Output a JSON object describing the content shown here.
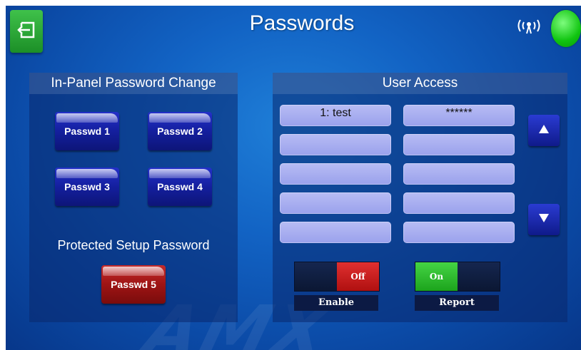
{
  "header": {
    "title": "Passwords",
    "exit_icon": "exit-icon",
    "wifi_icon": "wifi-signal-icon",
    "status_icon": "online-status-icon",
    "status_color": "#10c410"
  },
  "left_panel": {
    "title": "In-Panel Password Change",
    "buttons": [
      "Passwd 1",
      "Passwd 2",
      "Passwd 3",
      "Passwd 4"
    ],
    "protected_label": "Protected Setup Password",
    "protected_button": "Passwd 5"
  },
  "user_access": {
    "title": "User Access",
    "rows": [
      {
        "user": "1:  test",
        "password": "******"
      },
      {
        "user": "",
        "password": ""
      },
      {
        "user": "",
        "password": ""
      },
      {
        "user": "",
        "password": ""
      },
      {
        "user": "",
        "password": ""
      }
    ],
    "scroll_up_icon": "arrow-up-icon",
    "scroll_down_icon": "arrow-down-icon",
    "enable": {
      "left": "",
      "right": "Off",
      "label": "Enable",
      "active_color": "#d02020"
    },
    "report": {
      "left": "On",
      "right": "",
      "label": "Report",
      "active_color": "#2cbc2c"
    }
  },
  "watermark": "AMX"
}
